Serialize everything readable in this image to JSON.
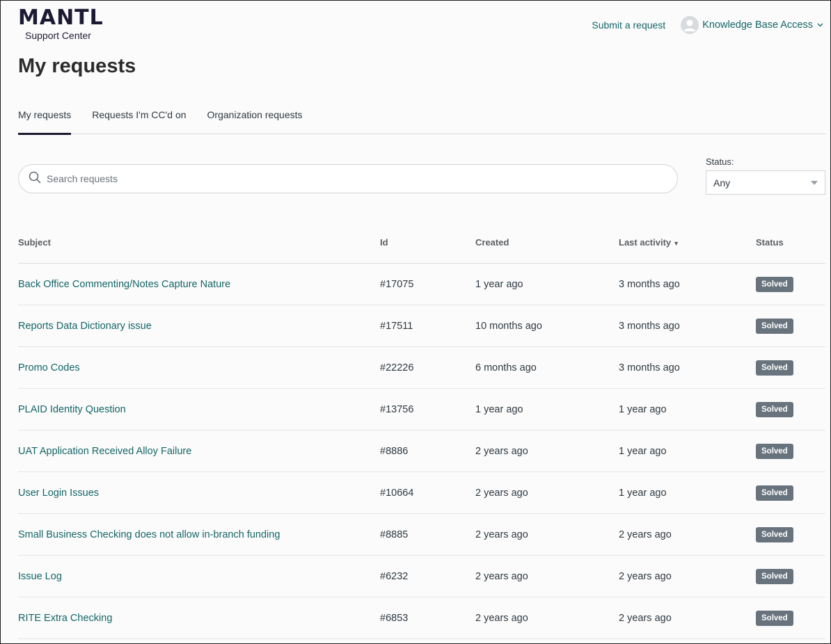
{
  "header": {
    "logo": "MANTL",
    "logo_sub": "Support Center",
    "submit_request": "Submit a request",
    "user_name": "Knowledge Base Access",
    "user_icon": "user-avatar-icon",
    "dropdown_icon": "chevron-down-icon"
  },
  "page_title": "My requests",
  "tabs": [
    {
      "label": "My requests",
      "active": true
    },
    {
      "label": "Requests I'm CC'd on",
      "active": false
    },
    {
      "label": "Organization requests",
      "active": false
    }
  ],
  "search": {
    "placeholder": "Search requests",
    "icon": "search-icon"
  },
  "status_filter": {
    "label": "Status:",
    "value": "Any"
  },
  "table": {
    "columns": [
      "Subject",
      "Id",
      "Created",
      "Last activity",
      "Status"
    ],
    "sort_indicator": "▼",
    "rows": [
      {
        "subject": "Back Office Commenting/Notes Capture Nature",
        "id": "#17075",
        "created": "1 year ago",
        "last_activity": "3 months ago",
        "status": "Solved"
      },
      {
        "subject": "Reports Data Dictionary issue",
        "id": "#17511",
        "created": "10 months ago",
        "last_activity": "3 months ago",
        "status": "Solved"
      },
      {
        "subject": "Promo Codes",
        "id": "#22226",
        "created": "6 months ago",
        "last_activity": "3 months ago",
        "status": "Solved"
      },
      {
        "subject": "PLAID Identity Question",
        "id": "#13756",
        "created": "1 year ago",
        "last_activity": "1 year ago",
        "status": "Solved"
      },
      {
        "subject": "UAT Application Received Alloy Failure",
        "id": "#8886",
        "created": "2 years ago",
        "last_activity": "1 year ago",
        "status": "Solved"
      },
      {
        "subject": "User Login Issues",
        "id": "#10664",
        "created": "2 years ago",
        "last_activity": "1 year ago",
        "status": "Solved"
      },
      {
        "subject": "Small Business Checking does not allow in-branch funding",
        "id": "#8885",
        "created": "2 years ago",
        "last_activity": "2 years ago",
        "status": "Solved"
      },
      {
        "subject": "Issue Log",
        "id": "#6232",
        "created": "2 years ago",
        "last_activity": "2 years ago",
        "status": "Solved"
      },
      {
        "subject": "RITE Extra Checking",
        "id": "#6853",
        "created": "2 years ago",
        "last_activity": "2 years ago",
        "status": "Solved"
      }
    ]
  },
  "colors": {
    "link": "#146566",
    "badge": "#68737d",
    "tab_active": "#1c1a33"
  }
}
